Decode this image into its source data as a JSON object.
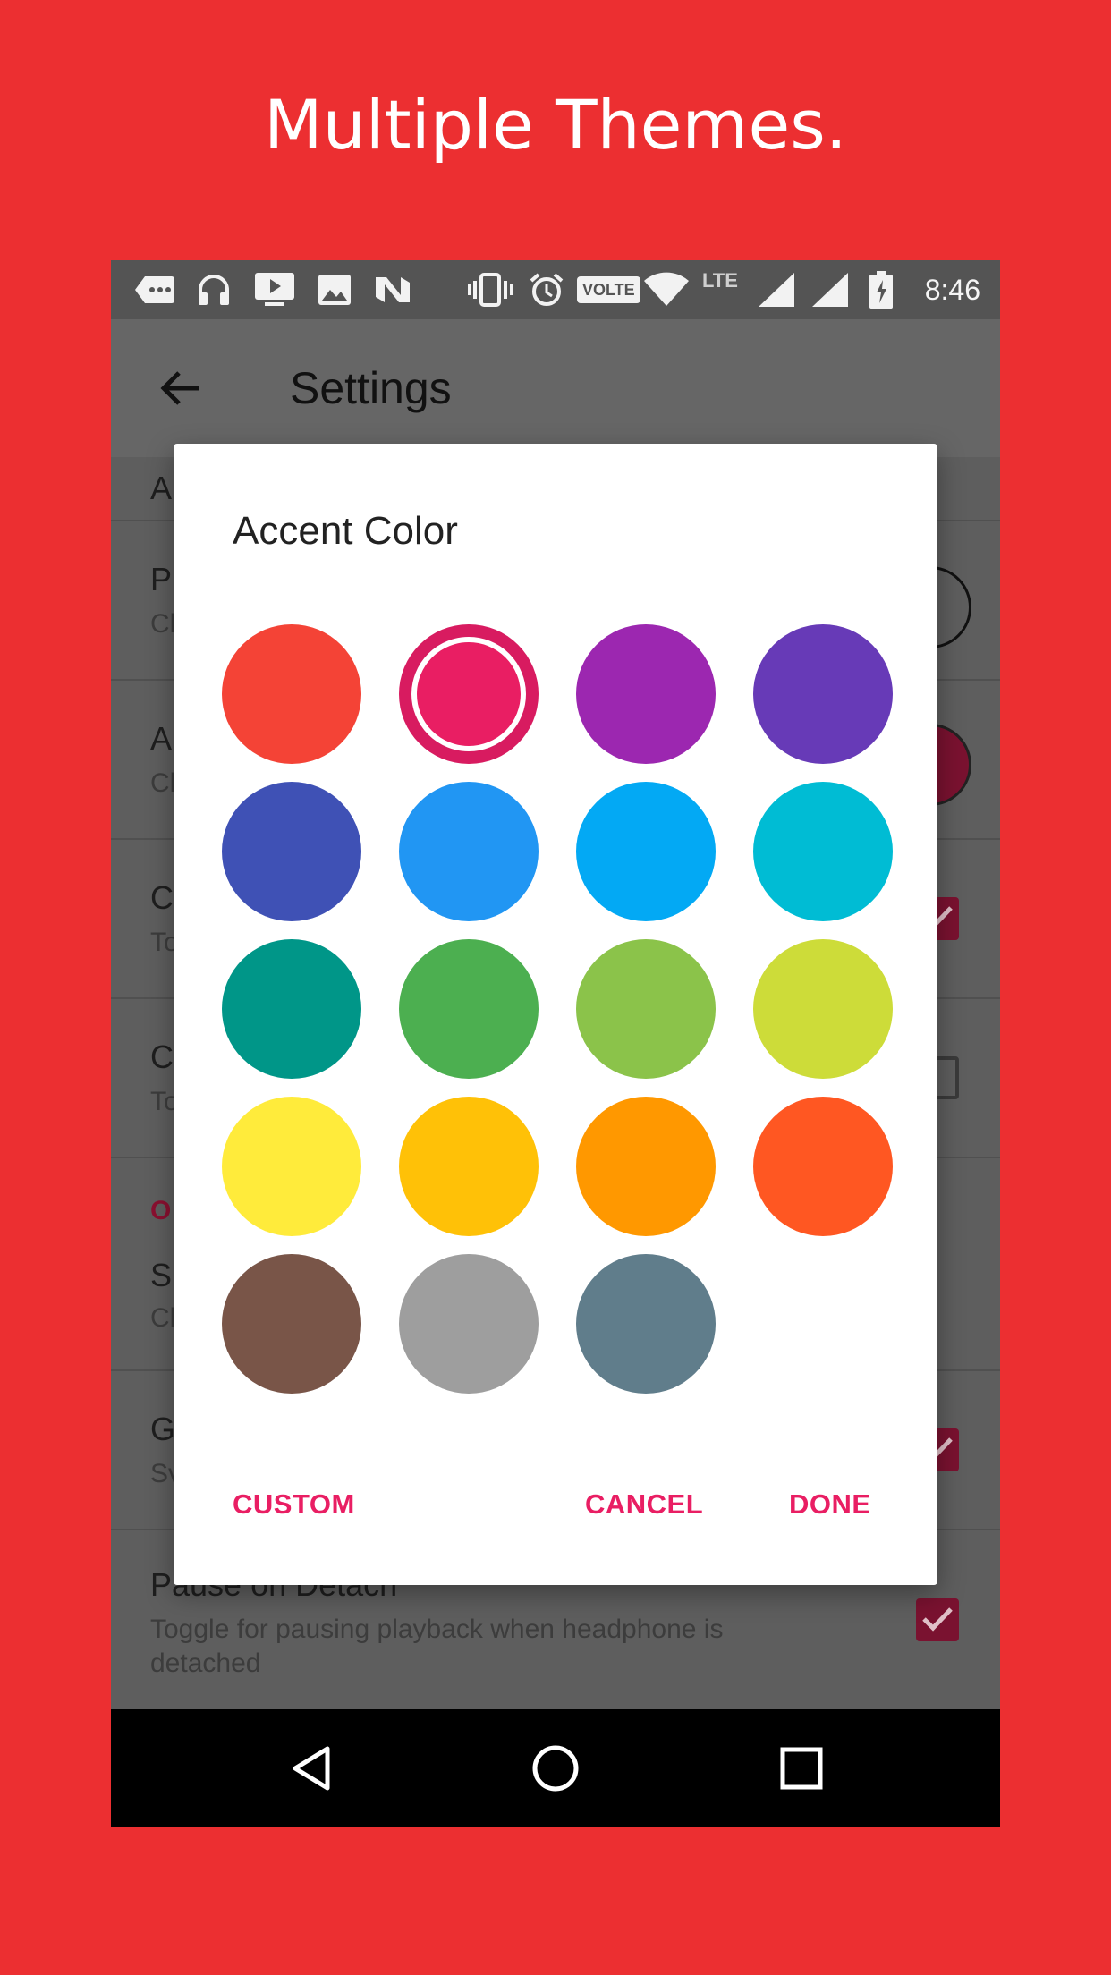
{
  "promo": {
    "title": "Multiple Themes."
  },
  "status_bar": {
    "time": "8:46",
    "volte": "VOLTE",
    "lte": "LTE",
    "left_icons": [
      "more-notifications-icon",
      "headphones-icon",
      "cast-play-icon",
      "image-icon",
      "n-logo-icon"
    ],
    "right_icons": [
      "vibrate-icon",
      "alarm-icon",
      "volte-icon",
      "wifi-icon",
      "lte-icon",
      "signal-icon",
      "signal-icon",
      "battery-charging-icon"
    ]
  },
  "app_bar": {
    "title": "Settings",
    "back_icon": "arrow-back-icon"
  },
  "settings": {
    "rows": [
      {
        "title": "A",
        "summary": ""
      },
      {
        "title": "P",
        "summary": "Cl"
      },
      {
        "title": "A",
        "summary": "Cl"
      },
      {
        "title": "C",
        "summary": "To"
      },
      {
        "title": "C",
        "summary": "To"
      },
      {
        "section": "O"
      },
      {
        "title": "S",
        "summary": "Cl"
      },
      {
        "title": "G",
        "summary": "Sv"
      },
      {
        "title": "Pause on Detach",
        "summary_line1": "Toggle for pausing playback when headphone is",
        "summary_line2": "detached"
      }
    ],
    "accent_swatch_color": "#7a1230",
    "checkbox_color": "#7a1230"
  },
  "dialog": {
    "title": "Accent Color",
    "selected_index": 1,
    "swatches": [
      {
        "name": "red",
        "color": "#f44336"
      },
      {
        "name": "pink",
        "color": "#e91e63"
      },
      {
        "name": "purple",
        "color": "#9c27b0"
      },
      {
        "name": "deep-purple",
        "color": "#673ab7"
      },
      {
        "name": "indigo",
        "color": "#3f51b5"
      },
      {
        "name": "blue",
        "color": "#2196f3"
      },
      {
        "name": "light-blue",
        "color": "#03a9f4"
      },
      {
        "name": "cyan",
        "color": "#00bcd4"
      },
      {
        "name": "teal",
        "color": "#009688"
      },
      {
        "name": "green",
        "color": "#4caf50"
      },
      {
        "name": "light-green",
        "color": "#8bc34a"
      },
      {
        "name": "lime",
        "color": "#cddc39"
      },
      {
        "name": "yellow",
        "color": "#ffeb3b"
      },
      {
        "name": "amber",
        "color": "#ffc107"
      },
      {
        "name": "orange",
        "color": "#ff9800"
      },
      {
        "name": "deep-orange",
        "color": "#ff5722"
      },
      {
        "name": "brown",
        "color": "#795548"
      },
      {
        "name": "grey",
        "color": "#9e9e9e"
      },
      {
        "name": "blue-grey",
        "color": "#607d8b"
      }
    ],
    "buttons": {
      "custom": "CUSTOM",
      "cancel": "CANCEL",
      "done": "DONE"
    },
    "button_color": "#e91e63"
  },
  "nav_bar": {
    "icons": [
      "nav-back-icon",
      "nav-home-icon",
      "nav-recents-icon"
    ]
  },
  "colors": {
    "background": "#ec2f31",
    "accent": "#e91e63"
  }
}
